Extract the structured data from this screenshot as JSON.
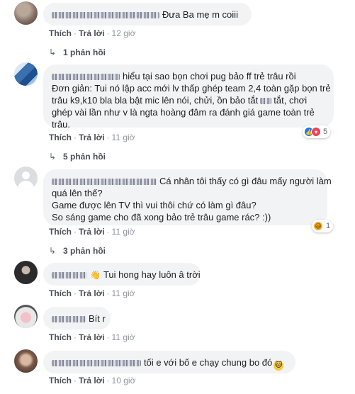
{
  "comments": [
    {
      "text": "Đưa Ba mẹ m coiii",
      "actions": {
        "like": "Thích",
        "reply": "Trả lời",
        "time": "12 giờ"
      },
      "replies": "1 phản hồi"
    },
    {
      "line1": "hiểu tại sao bọn chơi pug bảo ff trẻ trâu rồi",
      "line2": "Đơn giản: Tui nó lập acc mới lv thấp ghép team 2,4 toàn gặp bọn trẻ",
      "line3a": "trâu k9,k10 bla bla bật mic lên nói, chửi, ồn bảo tắt",
      "line3b": "tắt, chơi",
      "line4": "ghép vài lần như v là ngta hoàng đâm ra đánh giá game toàn trẻ",
      "line5": "trâu.",
      "reaction_count": "5",
      "actions": {
        "like": "Thích",
        "reply": "Trả lời",
        "time": "11 giờ"
      },
      "replies": "5 phản hồi"
    },
    {
      "line1": "Cá nhân tôi thấy có gì đâu mấy người làm",
      "line2": "quá lên thế?",
      "line3": "Game được lên TV thì vui thôi chứ có làm gì đâu?",
      "line4": "So sáng game cho đã xong bảo trẻ trâu game rác? :))",
      "reaction_count": "1",
      "actions": {
        "like": "Thích",
        "reply": "Trả lời",
        "time": "11 giờ"
      },
      "replies": "3 phản hồi"
    },
    {
      "text": "Tui hong hay luôn â trời",
      "actions": {
        "like": "Thích",
        "reply": "Trả lời",
        "time": "11 giờ"
      }
    },
    {
      "text": "Bít r",
      "actions": {
        "like": "Thích",
        "reply": "Trả lời",
        "time": "11 giờ"
      }
    },
    {
      "text": "tối e với bố e chạy chung bo đó",
      "actions": {
        "like": "Thích",
        "reply": "Trả lời",
        "time": "10 giờ"
      }
    }
  ],
  "icons": {
    "reply_arrow": "reply-arrow-icon",
    "like": "like-icon",
    "love": "love-icon",
    "haha": "haha-icon"
  },
  "colors": {
    "bubble": "#f2f3f5",
    "link": "#4b4f56",
    "meta": "#90949c",
    "like": "#1877f2",
    "love": "#f33e58"
  }
}
